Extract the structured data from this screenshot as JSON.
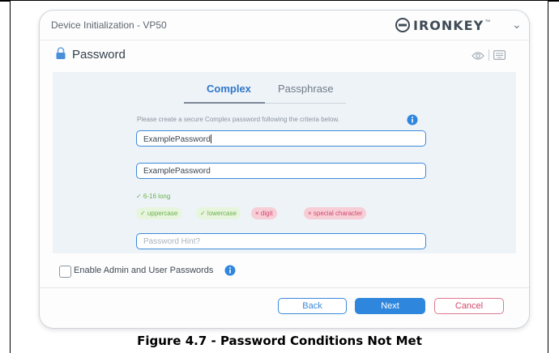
{
  "window": {
    "title": "Device Initialization - VP50",
    "brand": "IRONKEY",
    "brand_tm": "™",
    "chevron": "⌄"
  },
  "section": {
    "title": "Password",
    "icons": [
      "lock-icon",
      "eye-icon",
      "keyboard-icon"
    ]
  },
  "tabs": [
    {
      "label": "Complex",
      "active": true
    },
    {
      "label": "Passphrase",
      "active": false
    }
  ],
  "instruction": "Please create a secure Complex password following the criteria below.",
  "fields": {
    "password": "ExamplePassword",
    "confirm": "ExamplePassword",
    "hint_placeholder": "Password Hint?"
  },
  "criteria": [
    {
      "label": "✓ 6-16 long",
      "met": true
    },
    {
      "label": "✓ uppercase",
      "met": true
    },
    {
      "label": "✓ lowercase",
      "met": true
    },
    {
      "label": "× digit",
      "met": false
    },
    {
      "label": "× special character",
      "met": false
    }
  ],
  "admin_option": {
    "label": "Enable Admin and User Passwords",
    "checked": false
  },
  "buttons": {
    "back": "Back",
    "next": "Next",
    "cancel": "Cancel"
  },
  "caption": "Figure 4.7 - Password Conditions Not Met",
  "colors": {
    "accent": "#2f86dd",
    "met": "#6ab04c",
    "unmet": "#d14b6b",
    "panel": "#eef3f8"
  }
}
